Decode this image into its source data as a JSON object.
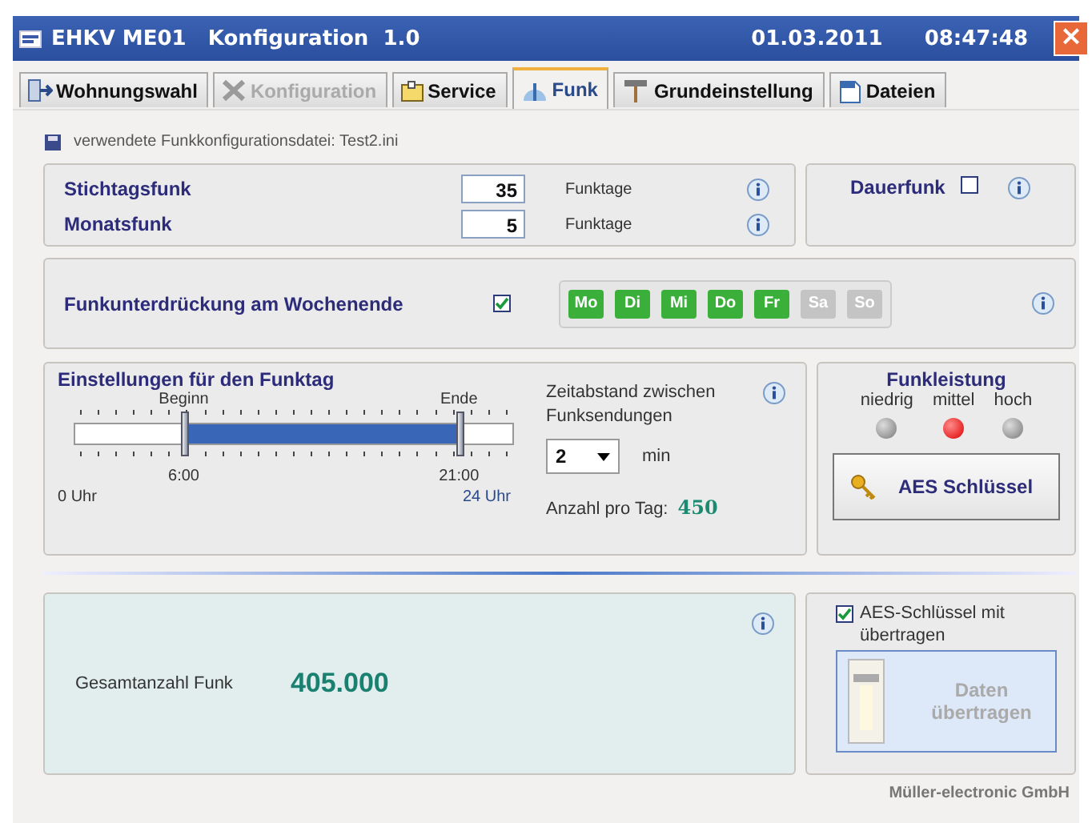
{
  "window": {
    "title": "EHKV ME01   Konfiguration  1.0",
    "date": "01.03.2011",
    "time": "08:47:48",
    "close": "×"
  },
  "tabs": [
    {
      "label": "Wohnungswahl",
      "selected": false,
      "disabled": false
    },
    {
      "label": "Konfiguration",
      "selected": false,
      "disabled": true
    },
    {
      "label": "Service",
      "selected": false,
      "disabled": false
    },
    {
      "label": "Funk",
      "selected": true,
      "disabled": false
    },
    {
      "label": "Grundeinstellung",
      "selected": false,
      "disabled": false
    },
    {
      "label": "Dateien",
      "selected": false,
      "disabled": false
    }
  ],
  "config_file": "verwendete Funkkonfigurationsdatei: Test2.ini",
  "counts": [
    {
      "label": "Stichtagsfunk",
      "value": "35",
      "unit": "Funktage"
    },
    {
      "label": "Monatsfunk",
      "value": "5",
      "unit": "Funktage"
    }
  ],
  "continuous": {
    "label": "Dauerfunk",
    "checked": false
  },
  "weekend": {
    "label": "Funkunterdrückung am Wochenende",
    "checked": true,
    "days": [
      {
        "label": "Mo",
        "on": true
      },
      {
        "label": "Di",
        "on": true
      },
      {
        "label": "Mi",
        "on": true
      },
      {
        "label": "Do",
        "on": true
      },
      {
        "label": "Fr",
        "on": true
      },
      {
        "label": "Sa",
        "on": false
      },
      {
        "label": "So",
        "on": false
      }
    ]
  },
  "day_settings": {
    "title": "Einstellungen für den Funktag",
    "begin": {
      "heading": "Beginn",
      "time": "6:00",
      "level": 0.25
    },
    "end": {
      "heading": "Ende",
      "time": "21:00",
      "level": 0.875
    },
    "min_label": "0 Uhr",
    "max_label": "24 Uhr",
    "interval_label": "Zeitabstand zwischen Funksendungen",
    "interval_value": "2",
    "interval_unit": "min",
    "per_day_label": "Anzahl pro Tag:",
    "per_day_value": "450"
  },
  "power": {
    "title": "Funkleistung",
    "levels": [
      {
        "label": "niedrig",
        "selected": false
      },
      {
        "label": "mittel",
        "selected": true
      },
      {
        "label": "hoch",
        "selected": false
      }
    ],
    "aes_button": "AES Schlüssel"
  },
  "total": {
    "label": "Gesamtanzahl Funk",
    "value": "405.000"
  },
  "transfer": {
    "aes_label": "AES-Schlüssel mit übertragen",
    "aes_checked": true,
    "button": "Daten übertragen",
    "disabled": true
  },
  "footer": "Müller-electronic GmbH"
}
